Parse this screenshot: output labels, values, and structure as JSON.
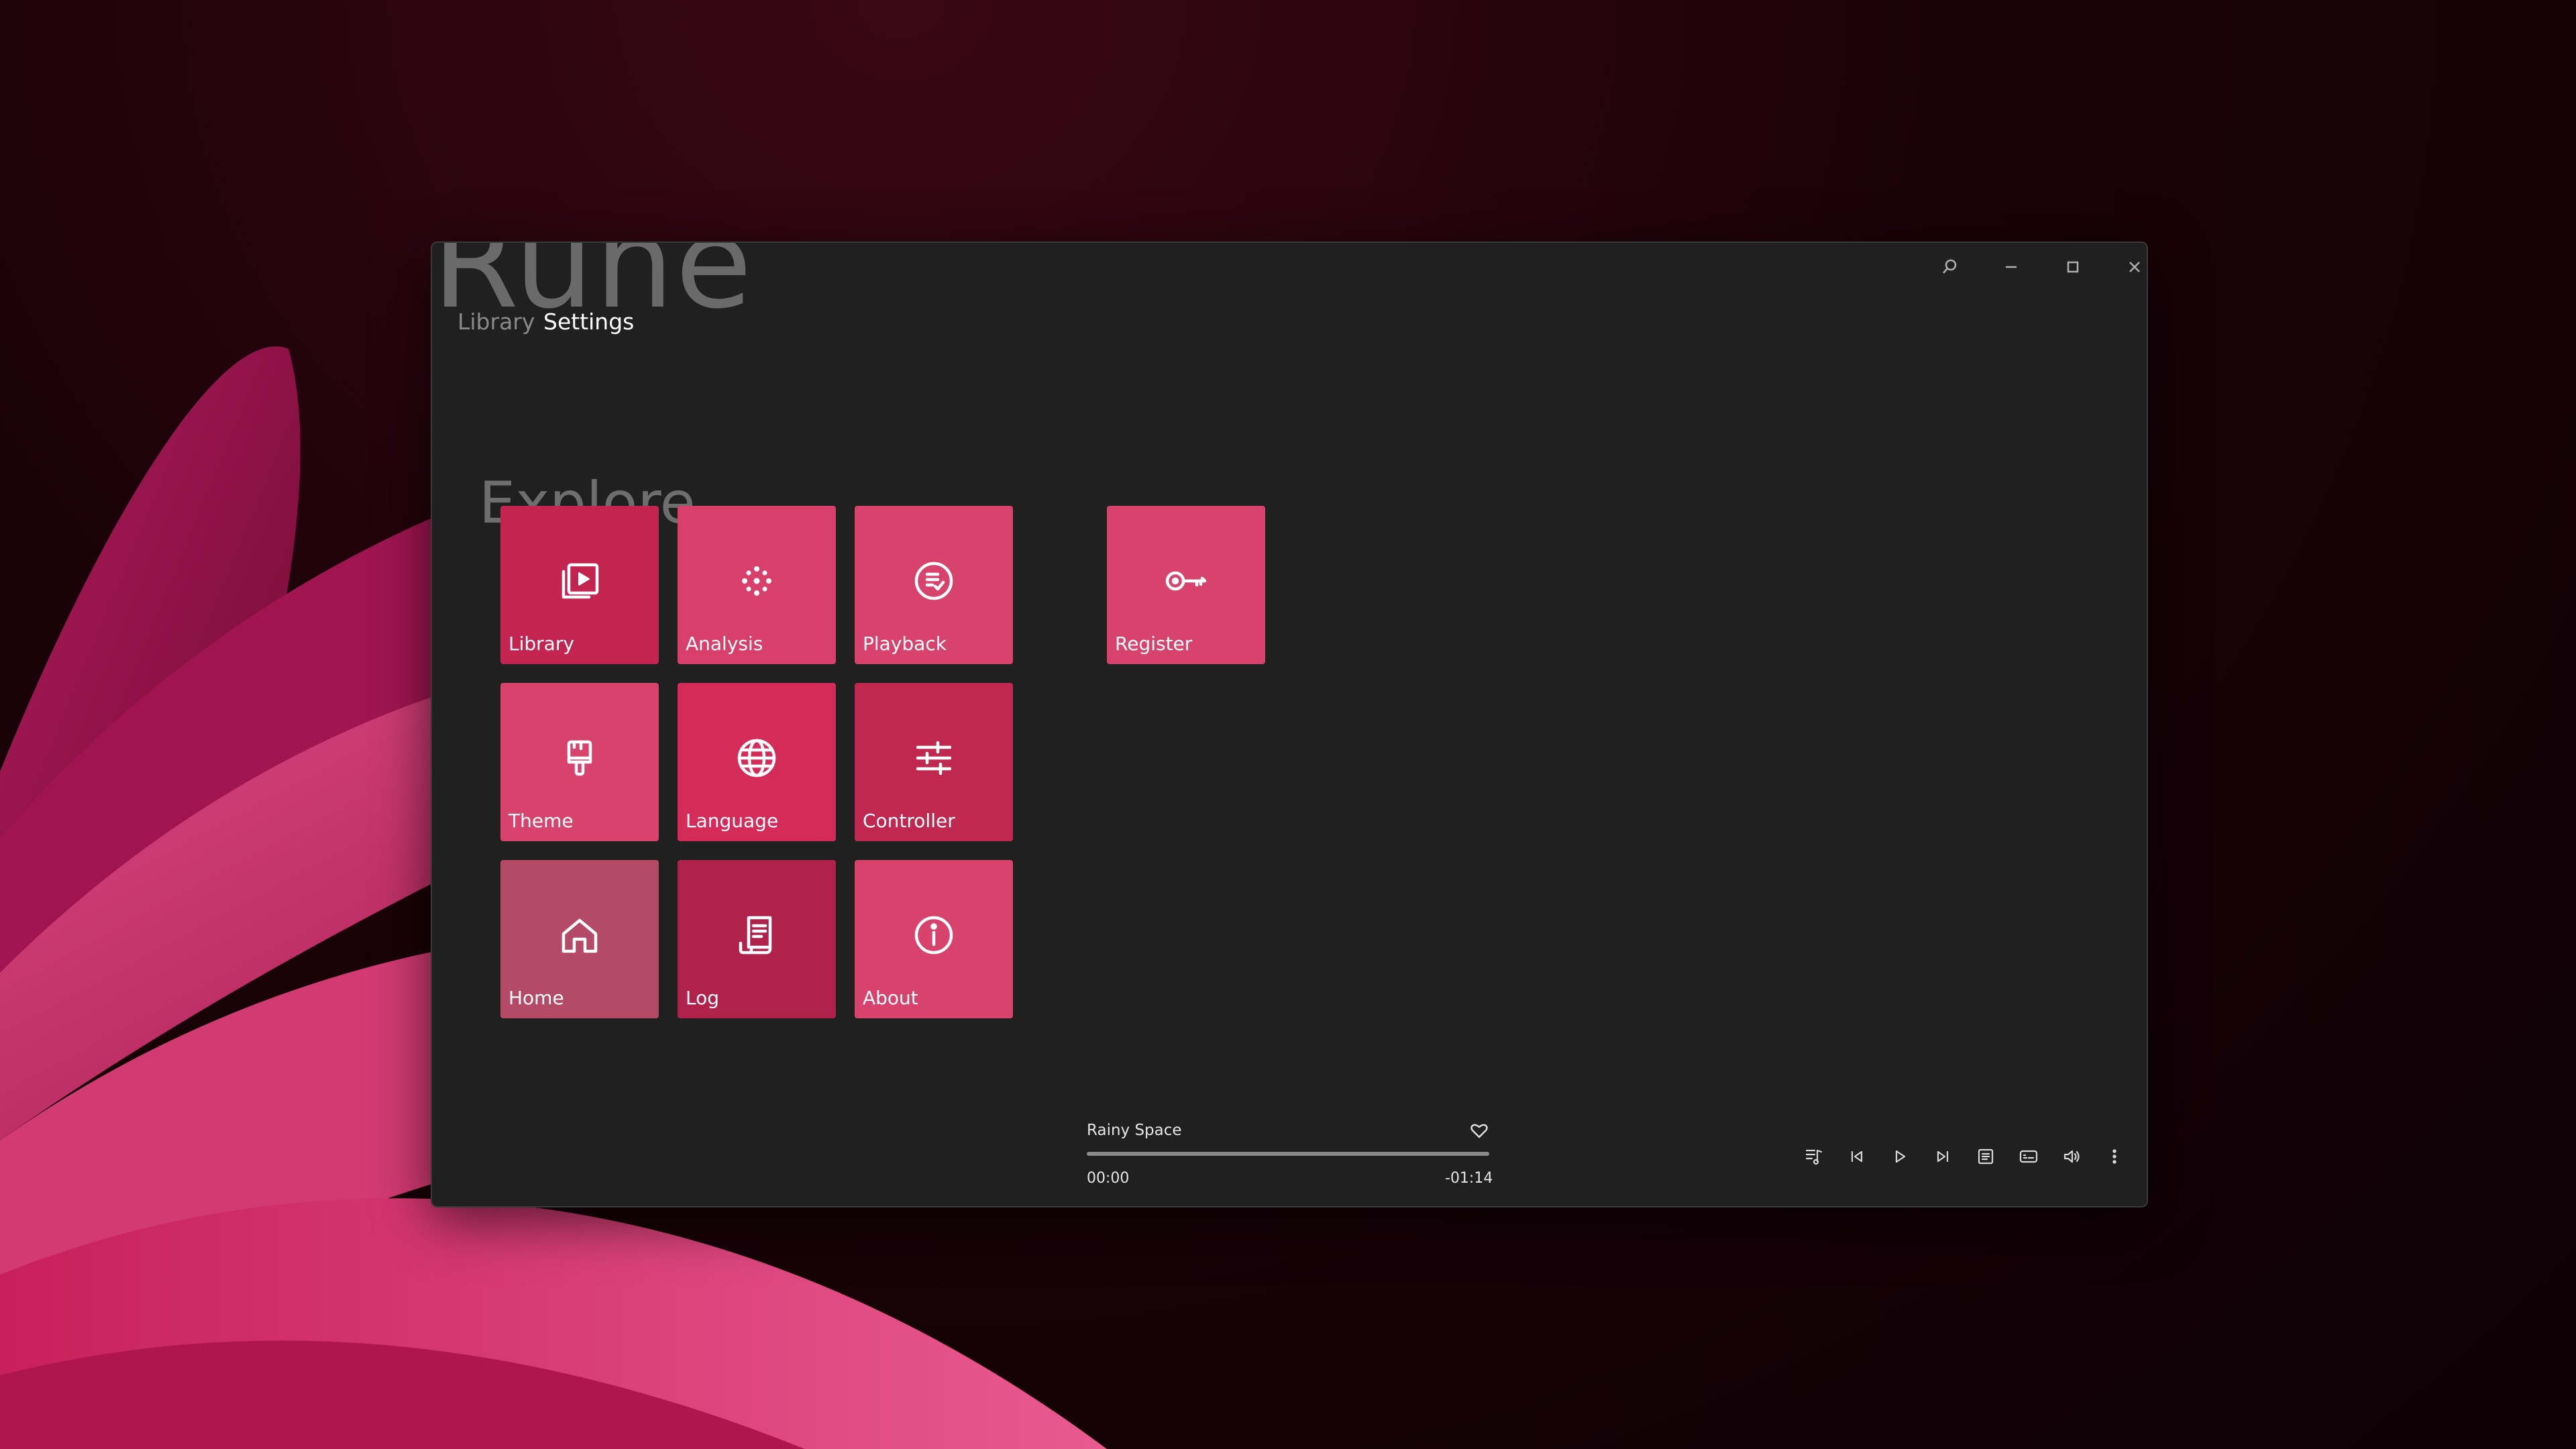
{
  "app": {
    "logo_text": "Rune"
  },
  "top_nav": {
    "items": [
      {
        "label": "Library"
      },
      {
        "label": "Settings"
      }
    ]
  },
  "title_bar": {
    "buttons": [
      "search-icon",
      "minimize-icon",
      "maximize-icon",
      "close-icon"
    ]
  },
  "section": {
    "title": "Explore"
  },
  "tiles": [
    {
      "label": "Library",
      "icon": "library-icon",
      "color": "#c32450"
    },
    {
      "label": "Analysis",
      "icon": "analysis-icon",
      "color": "#d83f6b"
    },
    {
      "label": "Playback",
      "icon": "playback-icon",
      "color": "#d8436d"
    },
    {
      "label": "Register",
      "icon": "key-icon",
      "color": "#d8436d"
    },
    {
      "label": "Theme",
      "icon": "paint-brush-icon",
      "color": "#d8436d"
    },
    {
      "label": "Language",
      "icon": "globe-icon",
      "color": "#d42b58"
    },
    {
      "label": "Controller",
      "icon": "sliders-icon",
      "color": "#c0284f"
    },
    {
      "label": "Home",
      "icon": "home-icon",
      "color": "#b54a68"
    },
    {
      "label": "Log",
      "icon": "log-icon",
      "color": "#b0214b"
    },
    {
      "label": "About",
      "icon": "info-icon",
      "color": "#d8436d"
    }
  ],
  "player": {
    "track_title": "Rainy Space",
    "time_elapsed": "00:00",
    "time_remaining": "-01:14",
    "progress": 0.0,
    "controls": [
      "playlist-icon",
      "previous-icon",
      "play-icon",
      "next-icon",
      "queue-icon",
      "lyrics-icon",
      "volume-icon",
      "more-icon"
    ]
  }
}
